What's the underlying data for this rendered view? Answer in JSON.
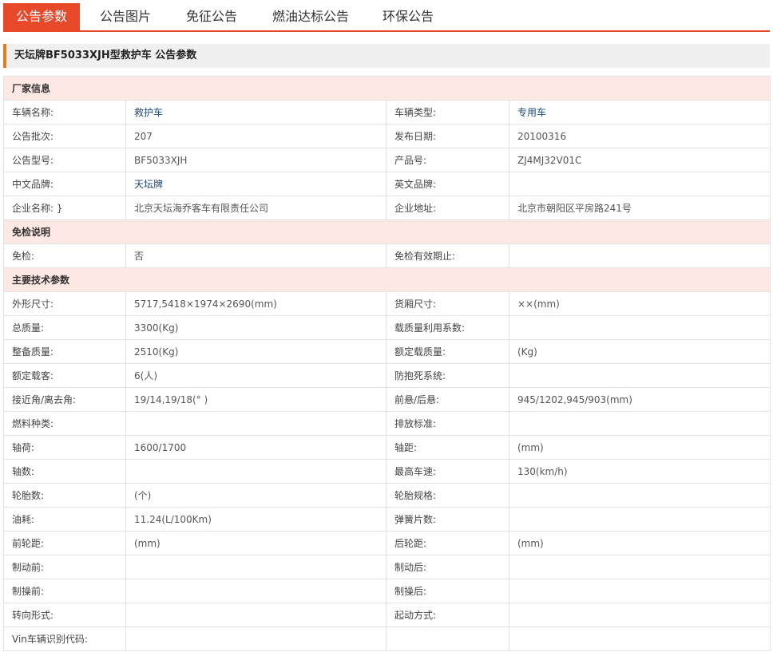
{
  "tabs": [
    {
      "label": "公告参数",
      "active": true
    },
    {
      "label": "公告图片",
      "active": false
    },
    {
      "label": "免征公告",
      "active": false
    },
    {
      "label": "燃油达标公告",
      "active": false
    },
    {
      "label": "环保公告",
      "active": false
    }
  ],
  "page_title": "天坛牌BF5033XJH型救护车 公告参数",
  "sections": {
    "manufacturer": "厂家信息",
    "exemption": "免检说明",
    "tech": "主要技术参数"
  },
  "rows": [
    {
      "l1": "车辆名称:",
      "v1": "救护车",
      "l2": "车辆类型:",
      "v2": "专用车"
    },
    {
      "l1": "公告批次:",
      "v1": "207",
      "l2": "发布日期:",
      "v2": "20100316"
    },
    {
      "l1": "公告型号:",
      "v1": "BF5033XJH",
      "l2": "产品号:",
      "v2": "ZJ4MJ32V01C"
    },
    {
      "l1": "中文品牌:",
      "v1": "天坛牌",
      "l2": "英文品牌:",
      "v2": ""
    },
    {
      "l1": "企业名称: }",
      "v1": "北京天坛海乔客车有限责任公司",
      "l2": "企业地址:",
      "v2": "北京市朝阳区平房路241号"
    },
    {
      "l1": "免检:",
      "v1": "否",
      "l2": "免检有效期止:",
      "v2": ""
    },
    {
      "l1": "外形尺寸:",
      "v1": "5717,5418×1974×2690(mm)",
      "l2": "货厢尺寸:",
      "v2": "××(mm)"
    },
    {
      "l1": "总质量:",
      "v1": "3300(Kg)",
      "l2": "载质量利用系数:",
      "v2": ""
    },
    {
      "l1": "整备质量:",
      "v1": "2510(Kg)",
      "l2": "额定载质量:",
      "v2": "(Kg)"
    },
    {
      "l1": "额定载客:",
      "v1": "6(人)",
      "l2": "防抱死系统:",
      "v2": ""
    },
    {
      "l1": "接近角/离去角:",
      "v1": "19/14,19/18(° )",
      "l2": "前悬/后悬:",
      "v2": "945/1202,945/903(mm)"
    },
    {
      "l1": "燃料种类:",
      "v1": "",
      "l2": "排放标准:",
      "v2": ""
    },
    {
      "l1": "轴荷:",
      "v1": "1600/1700",
      "l2": "轴距:",
      "v2": "(mm)"
    },
    {
      "l1": "轴数:",
      "v1": "",
      "l2": "最高车速:",
      "v2": "130(km/h)"
    },
    {
      "l1": "轮胎数:",
      "v1": "(个)",
      "l2": "轮胎规格:",
      "v2": ""
    },
    {
      "l1": "油耗:",
      "v1": "11.24(L/100Km)",
      "l2": "弹簧片数:",
      "v2": ""
    },
    {
      "l1": "前轮距:",
      "v1": "(mm)",
      "l2": "后轮距:",
      "v2": "(mm)"
    },
    {
      "l1": "制动前:",
      "v1": "",
      "l2": "制动后:",
      "v2": ""
    },
    {
      "l1": "制操前:",
      "v1": "",
      "l2": "制操后:",
      "v2": ""
    },
    {
      "l1": "转向形式:",
      "v1": "",
      "l2": "起动方式:",
      "v2": ""
    },
    {
      "l1": "Vin车辆识别代码:",
      "v1": "",
      "l2": "",
      "v2": ""
    }
  ]
}
